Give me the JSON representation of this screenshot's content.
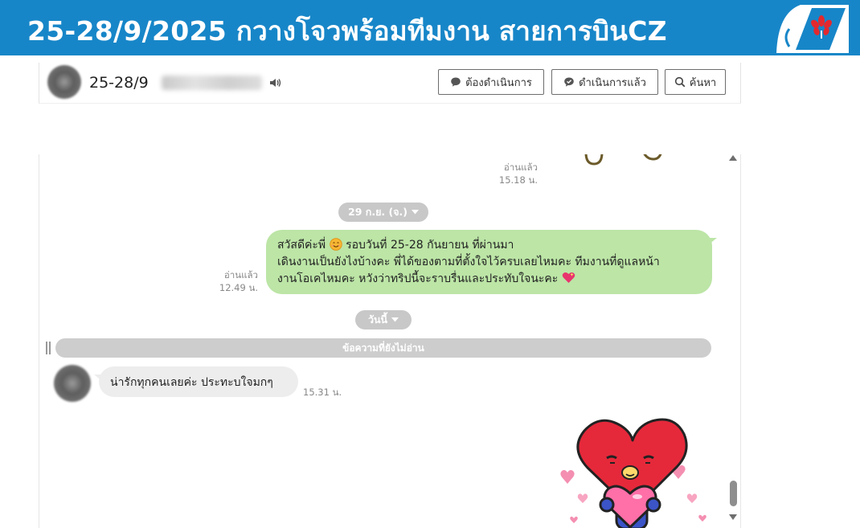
{
  "banner": {
    "title": "25-28/9/2025 กวางโจวพร้อมทีมงาน สายการบินCZ",
    "logo_icon": "kapok-flower-logo-icon",
    "background_color": "#1786c8",
    "logo_color": "#1786c8",
    "logo_flower_color": "#e3292e"
  },
  "chat_header": {
    "title": "25-28/9",
    "speaker_icon": "speaker-icon",
    "buttons": {
      "todo": "ต้องดำเนินการ",
      "done": "ดำเนินการแล้ว",
      "search": "ค้นหา"
    }
  },
  "messages": {
    "top_read": {
      "label": "อ่านแล้ว",
      "time": "15.18 น."
    },
    "date_divider": "29 ก.ย. (จ.)",
    "outgoing": {
      "read_label": "อ่านแล้ว",
      "time": "12.49 น.",
      "line1_a": "สวัสดีค่ะพี่",
      "line1_b": "รอบวันที่ 25-28 กันยายน ที่ผ่านมา",
      "line2": "เดินงานเป็นยังไงบ้างคะ พี่ได้ของตามที่ตั้งใจไว้ครบเลยไหมคะ ทีมงานที่ดูแลหน้า",
      "line3": "งานโอเคไหมคะ หวังว่าทริปนี้จะราบรื่นและประทับใจนะคะ",
      "emoji_smile_icon": "smiling-face-icon",
      "emoji_heart_icon": "sparkling-heart-icon",
      "bubble_color": "#bce5a6"
    },
    "today_divider": "วันนี้",
    "unread_divider": "ข้อความที่ยังไม่อ่าน",
    "incoming": {
      "text": "น่ารักทุกคนเลยค่ะ ประทะบใจมกๆ",
      "time": "15.31 น.",
      "bubble_color": "#ededed"
    },
    "sticker": "heart-character-sticker"
  }
}
